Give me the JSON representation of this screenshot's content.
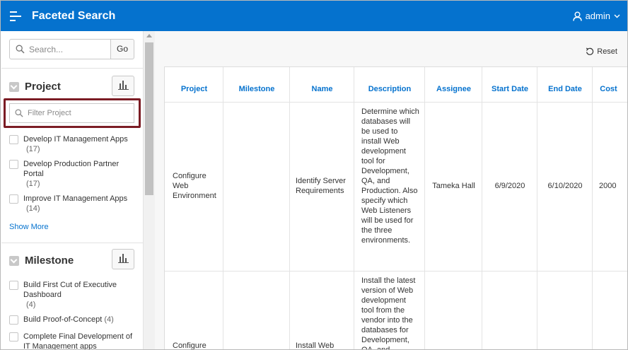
{
  "header": {
    "title": "Faceted Search",
    "user": "admin"
  },
  "sidebar": {
    "search_placeholder": "Search...",
    "go_label": "Go",
    "project_facet": {
      "title": "Project",
      "filter_placeholder": "Filter Project",
      "options": [
        {
          "label": "Develop IT Management Apps",
          "count": "(17)"
        },
        {
          "label": "Develop Production Partner Portal",
          "count": "(17)"
        },
        {
          "label": "Improve IT Management Apps",
          "count": "(14)"
        }
      ],
      "show_more": "Show More"
    },
    "milestone_facet": {
      "title": "Milestone",
      "options": [
        {
          "label": "Build First Cut of Executive Dashboard",
          "count": "(4)"
        },
        {
          "label": "Build Proof-of-Concept",
          "count": "(4)"
        },
        {
          "label": "Complete Final Development of IT Management apps",
          "count": ""
        }
      ]
    }
  },
  "report": {
    "reset_label": "Reset",
    "columns": [
      "Project",
      "Milestone",
      "Name",
      "Description",
      "Assignee",
      "Start Date",
      "End Date",
      "Cost"
    ],
    "rows": [
      {
        "project": "Configure Web Environment",
        "milestone": "",
        "name": "Identify Server Requirements",
        "description": "Determine which databases will be used to install Web development tool for Development, QA, and Production. Also specify which Web Listeners will be used for the three environments.",
        "assignee": "Tameka Hall",
        "start_date": "6/9/2020",
        "end_date": "6/10/2020",
        "cost": "2000"
      },
      {
        "project": "Configure",
        "milestone": "",
        "name": "Install Web",
        "description": "Install the latest version of Web development tool from the vendor into the databases for Development, QA, and",
        "assignee": "",
        "start_date": "",
        "end_date": "",
        "cost": ""
      }
    ]
  },
  "colors": {
    "header_bg": "#0572ce",
    "link": "#0572ce",
    "highlight_border": "#7b1c24"
  }
}
